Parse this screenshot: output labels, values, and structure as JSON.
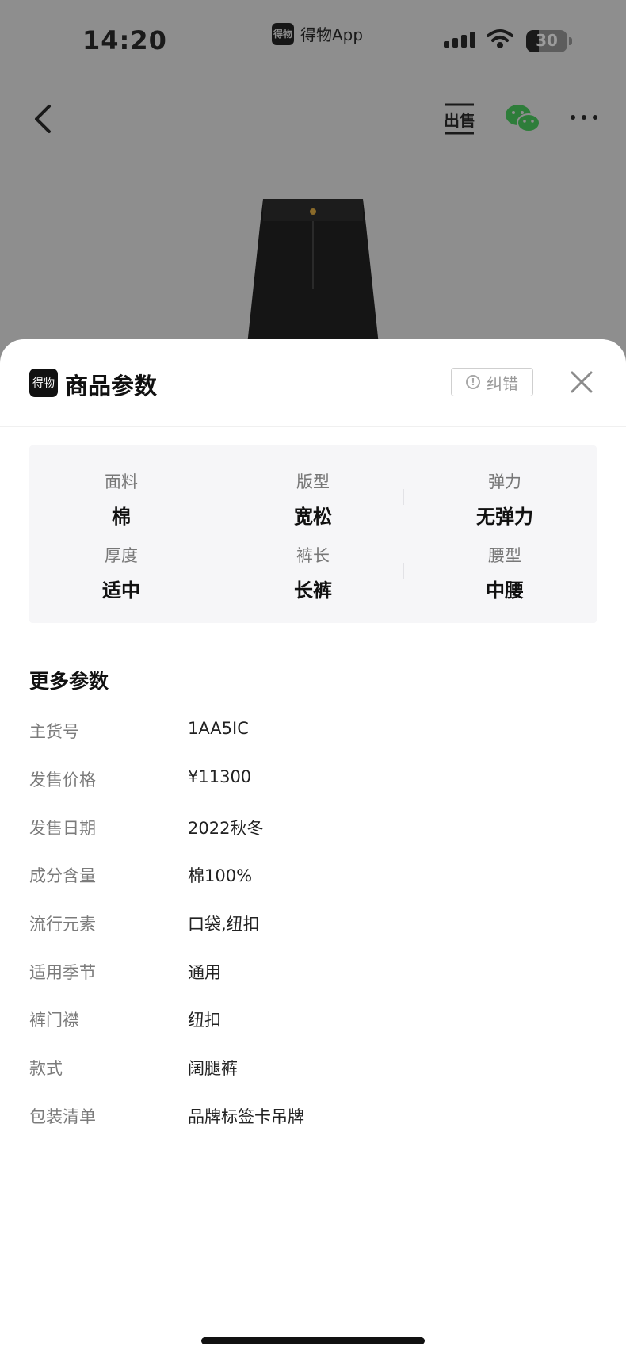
{
  "status_bar": {
    "time": "14:20",
    "app_name": "得物App",
    "app_logo_text": "得物",
    "battery": "30",
    "battery_level": 0.3
  },
  "nav": {
    "sell_label": "出售",
    "icons": [
      "back-icon",
      "sell-icon",
      "wechat-icon",
      "more-icon"
    ]
  },
  "sheet": {
    "logo_text": "得物",
    "title": "商品参数",
    "report_label": "纠错",
    "close_icon": "close-icon",
    "key_params": [
      {
        "key": "面料",
        "value": "棉"
      },
      {
        "key": "版型",
        "value": "宽松"
      },
      {
        "key": "弹力",
        "value": "无弹力"
      },
      {
        "key": "厚度",
        "value": "适中"
      },
      {
        "key": "裤长",
        "value": "长裤"
      },
      {
        "key": "腰型",
        "value": "中腰"
      }
    ],
    "more_title": "更多参数",
    "more_params": [
      {
        "key": "主货号",
        "value": "1AA5IC"
      },
      {
        "key": "发售价格",
        "value": "¥11300"
      },
      {
        "key": "发售日期",
        "value": "2022秋冬"
      },
      {
        "key": "成分含量",
        "value": "棉100%"
      },
      {
        "key": "流行元素",
        "value": "口袋,纽扣"
      },
      {
        "key": "适用季节",
        "value": "通用"
      },
      {
        "key": "裤门襟",
        "value": "纽扣"
      },
      {
        "key": "款式",
        "value": "阔腿裤"
      },
      {
        "key": "包装清单",
        "value": "品牌标签卡吊牌"
      }
    ]
  },
  "colors": {
    "overlay_bg": "#8e8e8e",
    "sheet_bg": "#ffffff",
    "grid_bg": "#f6f6f8",
    "key_text": "#7b7b7b",
    "value_text": "#222222"
  }
}
